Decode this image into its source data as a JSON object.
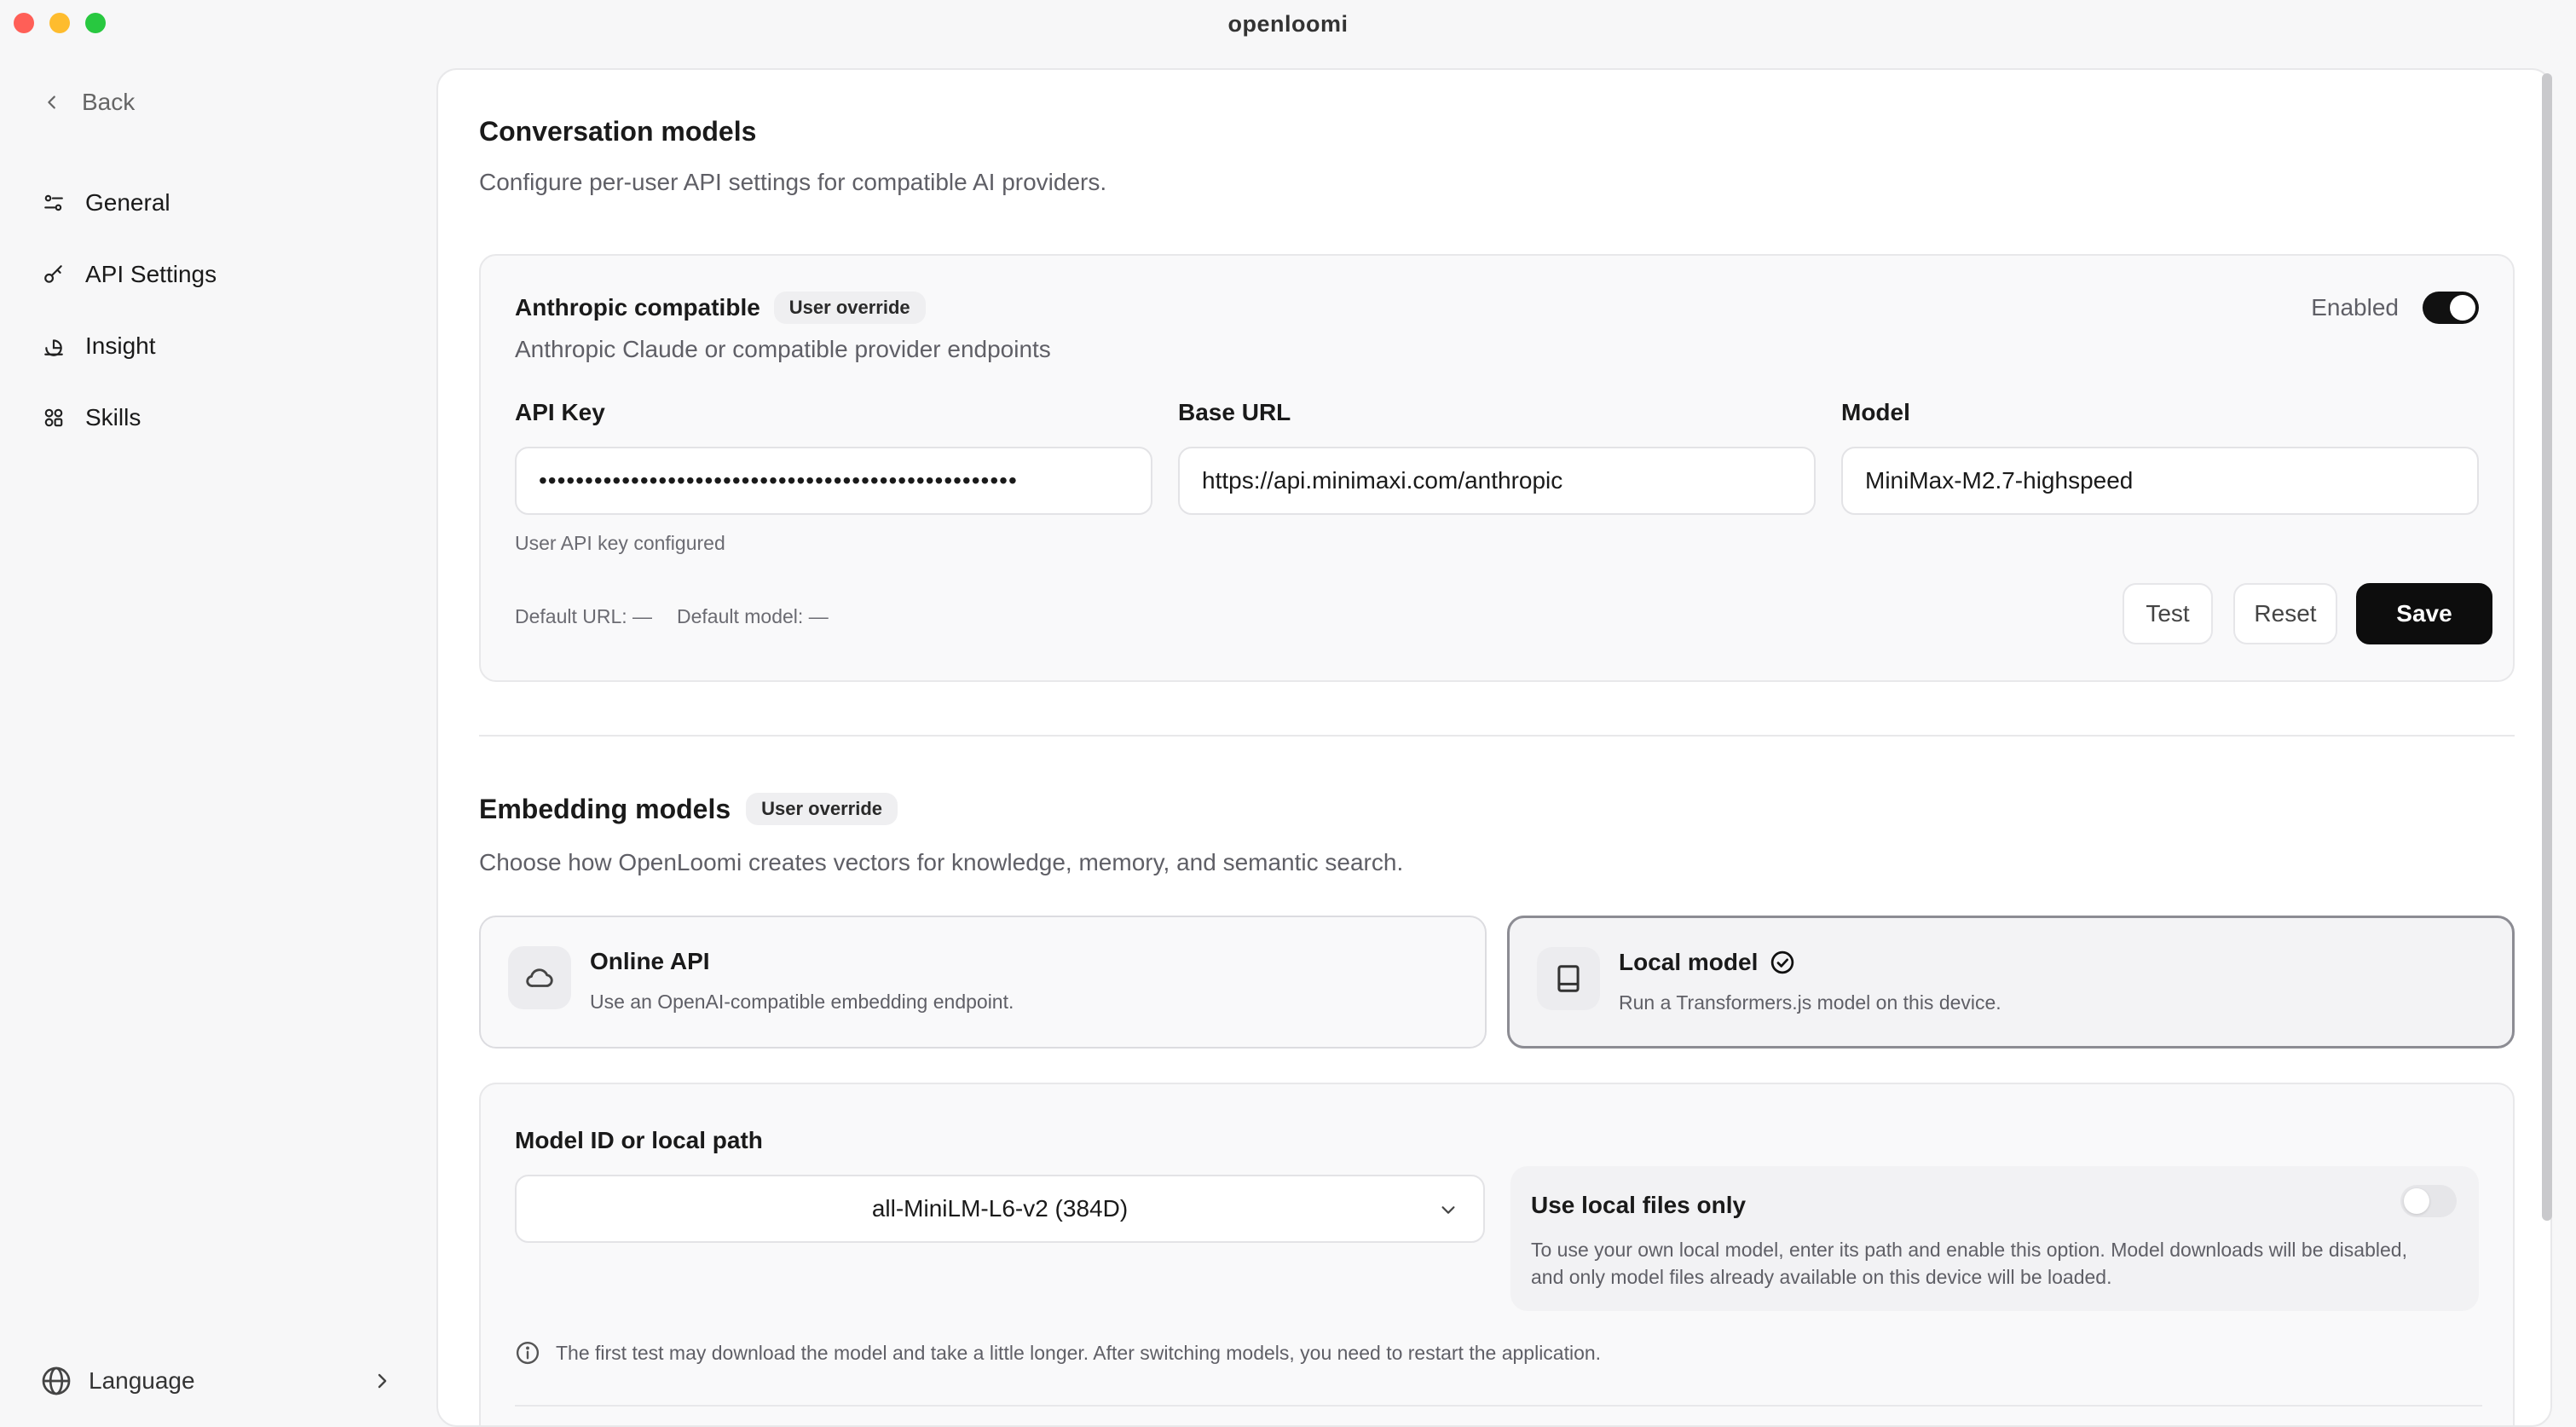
{
  "window": {
    "title": "openloomi"
  },
  "sidebar": {
    "back_label": "Back",
    "items": [
      {
        "label": "General",
        "icon": "sliders-icon"
      },
      {
        "label": "API Settings",
        "icon": "key-icon"
      },
      {
        "label": "Insight",
        "icon": "insight-icon"
      },
      {
        "label": "Skills",
        "icon": "skills-icon"
      }
    ],
    "language_label": "Language"
  },
  "conversation": {
    "title": "Conversation models",
    "description": "Configure per-user API settings for compatible AI providers.",
    "provider": {
      "name": "Anthropic compatible",
      "badge": "User override",
      "description": "Anthropic Claude or compatible provider endpoints",
      "enabled_label": "Enabled",
      "enabled": true,
      "api_key_label": "API Key",
      "api_key_value": "••••••••••••••••••••••••••••••••••••••••••••••••••••",
      "api_key_hint": "User API key configured",
      "base_url_label": "Base URL",
      "base_url_value": "https://api.minimaxi.com/anthropic",
      "model_label": "Model",
      "model_value": "MiniMax-M2.7-highspeed",
      "default_url": "Default URL: —",
      "default_model": "Default model: —",
      "test_label": "Test",
      "reset_label": "Reset",
      "save_label": "Save"
    }
  },
  "embedding": {
    "title": "Embedding models",
    "badge": "User override",
    "description": "Choose how OpenLoomi creates vectors for knowledge, memory, and semantic search.",
    "options": [
      {
        "title": "Online API",
        "description": "Use an OpenAI-compatible embedding endpoint.",
        "selected": false
      },
      {
        "title": "Local model",
        "description": "Run a Transformers.js model on this device.",
        "selected": true
      }
    ],
    "model_id_label": "Model ID or local path",
    "model_id_value": "all-MiniLM-L6-v2 (384D)",
    "local_only_title": "Use local files only",
    "local_only_desc": "To use your own local model, enter its path and enable this option. Model downloads will be disabled, and only model files already available on this device will be loaded.",
    "local_only_enabled": false,
    "info_note": "The first test may download the model and take a little longer. After switching models, you need to restart the application."
  },
  "colors": {
    "accent": "#0d0d0d",
    "background": "#f7f7f8",
    "panel": "#ffffff"
  }
}
